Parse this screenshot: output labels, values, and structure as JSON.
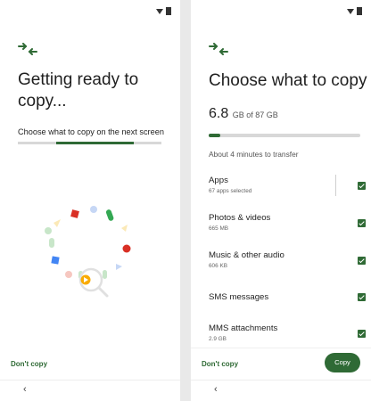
{
  "colors": {
    "accent": "#2f6a35",
    "background": "#ffffff",
    "text": "#1f1f1f"
  },
  "status_bar": {
    "icons": [
      "wifi-icon",
      "battery-icon"
    ]
  },
  "screen_left": {
    "title": "Getting ready to copy...",
    "subtitle": "Choose what to copy on the next screen",
    "dont_copy_label": "Don't copy",
    "animation_icons": [
      "triangle",
      "square",
      "circle",
      "pill",
      "play-icon",
      "magnifier-icon"
    ]
  },
  "screen_right": {
    "title": "Choose what to copy",
    "size_value": "6.8",
    "size_total": "GB of 87 GB",
    "progress": 0.078,
    "estimate": "About 4 minutes to transfer",
    "items": [
      {
        "name": "Apps",
        "meta": "67 apps selected",
        "checked": true
      },
      {
        "name": "Photos & videos",
        "meta": "665 MB",
        "checked": true
      },
      {
        "name": "Music & other audio",
        "meta": "606 KB",
        "checked": true
      },
      {
        "name": "SMS messages",
        "meta": "",
        "checked": true
      },
      {
        "name": "MMS attachments",
        "meta": "2.9 GB",
        "checked": true
      }
    ],
    "dont_copy_label": "Don't copy",
    "copy_label": "Copy"
  },
  "nav": {
    "back_glyph": "‹"
  }
}
